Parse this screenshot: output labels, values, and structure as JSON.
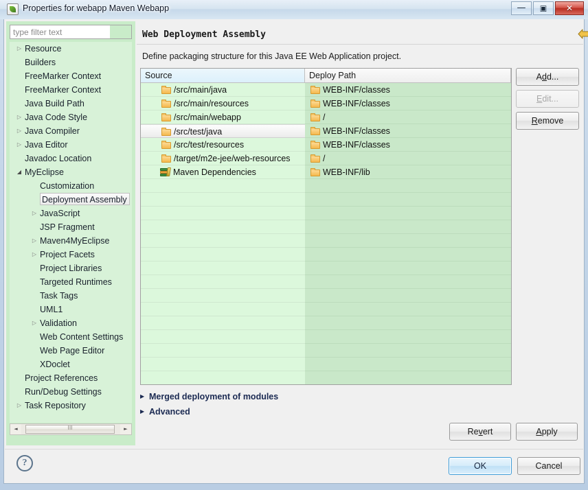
{
  "window": {
    "title": "Properties for webapp Maven Webapp",
    "icon": "myeclipse-leaf-icon",
    "controls": {
      "minimize": "—",
      "maximize": "▣",
      "close": "✕"
    }
  },
  "sidebar": {
    "filter": {
      "placeholder": "type filter text",
      "value": ""
    },
    "items": [
      {
        "label": "Resource",
        "indent": 0,
        "arrow": "collapsed",
        "selected": false
      },
      {
        "label": "Builders",
        "indent": 0,
        "arrow": "none",
        "selected": false
      },
      {
        "label": "FreeMarker Context",
        "indent": 0,
        "arrow": "none",
        "selected": false
      },
      {
        "label": "FreeMarker Context",
        "indent": 0,
        "arrow": "none",
        "selected": false
      },
      {
        "label": "Java Build Path",
        "indent": 0,
        "arrow": "none",
        "selected": false
      },
      {
        "label": "Java Code Style",
        "indent": 0,
        "arrow": "collapsed",
        "selected": false
      },
      {
        "label": "Java Compiler",
        "indent": 0,
        "arrow": "collapsed",
        "selected": false
      },
      {
        "label": "Java Editor",
        "indent": 0,
        "arrow": "collapsed",
        "selected": false
      },
      {
        "label": "Javadoc Location",
        "indent": 0,
        "arrow": "none",
        "selected": false
      },
      {
        "label": "MyEclipse",
        "indent": 0,
        "arrow": "expanded",
        "selected": false
      },
      {
        "label": "Customization",
        "indent": 1,
        "arrow": "none",
        "selected": false
      },
      {
        "label": "Deployment Assembly",
        "indent": 1,
        "arrow": "none",
        "selected": true
      },
      {
        "label": "JavaScript",
        "indent": 1,
        "arrow": "collapsed",
        "selected": false
      },
      {
        "label": "JSP Fragment",
        "indent": 1,
        "arrow": "none",
        "selected": false
      },
      {
        "label": "Maven4MyEclipse",
        "indent": 1,
        "arrow": "collapsed",
        "selected": false
      },
      {
        "label": "Project Facets",
        "indent": 1,
        "arrow": "collapsed",
        "selected": false
      },
      {
        "label": "Project Libraries",
        "indent": 1,
        "arrow": "none",
        "selected": false
      },
      {
        "label": "Targeted Runtimes",
        "indent": 1,
        "arrow": "none",
        "selected": false
      },
      {
        "label": "Task Tags",
        "indent": 1,
        "arrow": "none",
        "selected": false
      },
      {
        "label": "UML1",
        "indent": 1,
        "arrow": "none",
        "selected": false
      },
      {
        "label": "Validation",
        "indent": 1,
        "arrow": "collapsed",
        "selected": false
      },
      {
        "label": "Web Content Settings",
        "indent": 1,
        "arrow": "none",
        "selected": false
      },
      {
        "label": "Web Page Editor",
        "indent": 1,
        "arrow": "none",
        "selected": false
      },
      {
        "label": "XDoclet",
        "indent": 1,
        "arrow": "none",
        "selected": false
      },
      {
        "label": "Project References",
        "indent": 0,
        "arrow": "none",
        "selected": false
      },
      {
        "label": "Run/Debug Settings",
        "indent": 0,
        "arrow": "none",
        "selected": false
      },
      {
        "label": "Task Repository",
        "indent": 0,
        "arrow": "collapsed",
        "selected": false
      }
    ],
    "scrollbar": {
      "left_arrow": "◄",
      "right_arrow": "►"
    }
  },
  "page": {
    "title": "Web Deployment Assembly",
    "description": "Define packaging structure for this Java EE Web Application project.",
    "nav": {
      "back_icon": "back-arrow-icon",
      "back_menu_icon": "chevron-down-icon",
      "forward_icon": "forward-arrow-icon",
      "forward_menu_icon": "chevron-down-icon",
      "overflow_menu_icon": "chevron-down-icon"
    }
  },
  "table": {
    "columns": [
      "Source",
      "Deploy Path"
    ],
    "sort_column": "Source",
    "sort_indicator": "▲",
    "rows": [
      {
        "source": "/src/main/java",
        "deploy": "WEB-INF/classes",
        "icon": "folder-icon",
        "selected": false
      },
      {
        "source": "/src/main/resources",
        "deploy": "WEB-INF/classes",
        "icon": "folder-icon",
        "selected": false
      },
      {
        "source": "/src/main/webapp",
        "deploy": "/",
        "icon": "folder-icon",
        "selected": false
      },
      {
        "source": "/src/test/java",
        "deploy": "WEB-INF/classes",
        "icon": "folder-icon",
        "selected": true
      },
      {
        "source": "/src/test/resources",
        "deploy": "WEB-INF/classes",
        "icon": "folder-icon",
        "selected": false
      },
      {
        "source": "/target/m2e-jee/web-resources",
        "deploy": "/",
        "icon": "folder-icon",
        "selected": false
      },
      {
        "source": "Maven Dependencies",
        "deploy": "WEB-INF/lib",
        "icon": "books-icon",
        "selected": false
      }
    ],
    "empty_row_count": 15
  },
  "side_buttons": [
    {
      "label": "Add...",
      "mnemonic": "d",
      "enabled": true
    },
    {
      "label": "Edit...",
      "mnemonic": "E",
      "enabled": false
    },
    {
      "label": "Remove",
      "mnemonic": "R",
      "enabled": true
    }
  ],
  "expanders": [
    {
      "label": "Merged deployment of modules",
      "expanded": false,
      "triangle": "▶"
    },
    {
      "label": "Advanced",
      "expanded": false,
      "triangle": "▶"
    }
  ],
  "bottom_buttons": [
    {
      "label": "Revert",
      "mnemonic": "v"
    },
    {
      "label": "Apply",
      "mnemonic": "A"
    }
  ],
  "footer": {
    "help_icon": "help-question-icon",
    "help_glyph": "?",
    "ok_label": "OK",
    "cancel_label": "Cancel"
  },
  "colors": {
    "tree_background": "#d8f2d8",
    "table_source_column": "#dcf8dc",
    "table_deploy_column": "#c9e8c9",
    "accent_blue": "#3c9bd8",
    "expander_text": "#1b2a52",
    "close_button": "#b82e22"
  }
}
